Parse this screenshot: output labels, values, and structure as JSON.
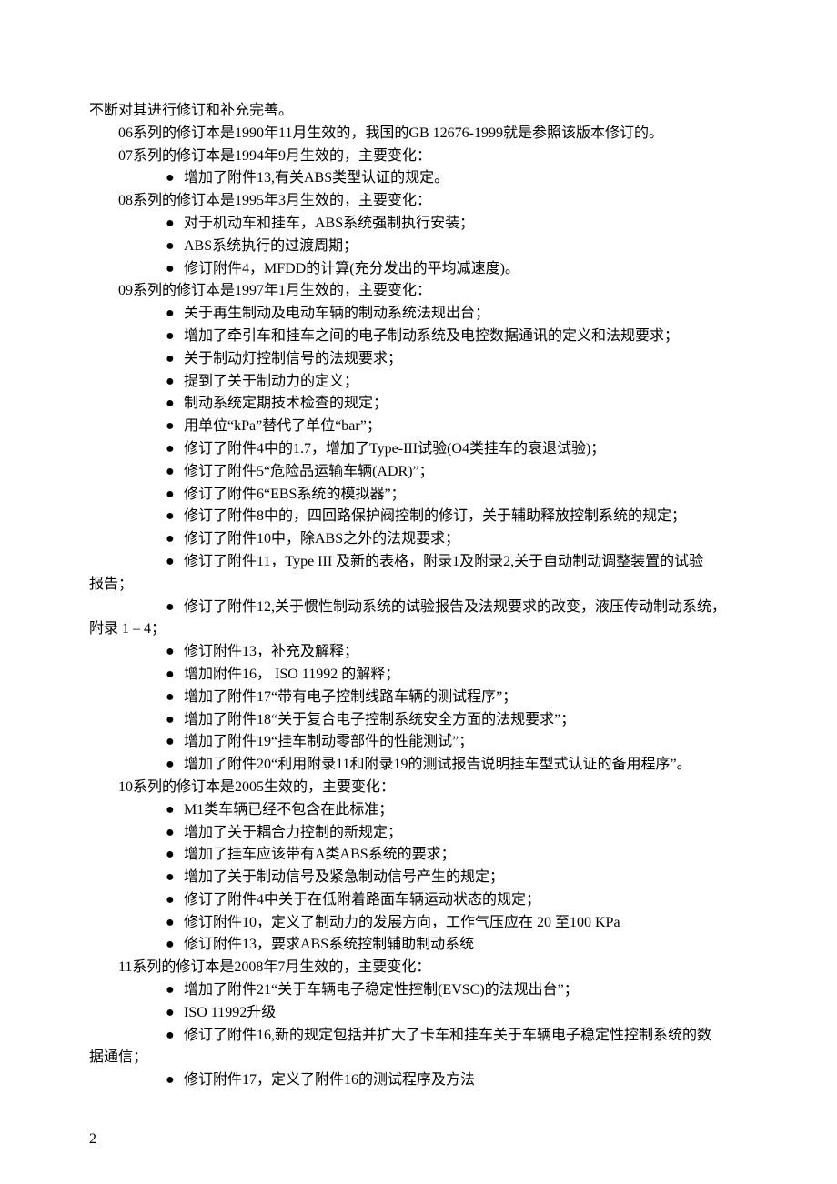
{
  "intro": "不断对其进行修订和补充完善。",
  "s06": "06系列的修订本是1990年11月生效的，我国的GB 12676-1999就是参照该版本修订的。",
  "s07_head": "07系列的修订本是1994年9月生效的，主要变化：",
  "s07": [
    "增加了附件13,有关ABS类型认证的规定。"
  ],
  "s08_head": "08系列的修订本是1995年3月生效的，主要变化：",
  "s08": [
    "对于机动车和挂车，ABS系统强制执行安装；",
    "ABS系统执行的过渡周期；",
    "修订附件4，MFDD的计算(充分发出的平均减速度)。"
  ],
  "s09_head": "09系列的修订本是1997年1月生效的，主要变化：",
  "s09a": [
    "关于再生制动及电动车辆的制动系统法规出台；",
    "增加了牵引车和挂车之间的电子制动系统及电控数据通讯的定义和法规要求；",
    "关于制动灯控制信号的法规要求；",
    "提到了关于制动力的定义；",
    "制动系统定期技术检查的规定；",
    "用单位“kPa”替代了单位“bar”；",
    "修订了附件4中的1.7，增加了Type-III试验(O4类挂车的衰退试验)；",
    "修订了附件5“危险品运输车辆(ADR)”；",
    "修订了附件6“EBS系统的模拟器”；",
    "修订了附件8中的，四回路保护阀控制的修订，关于辅助释放控制系统的规定；",
    "修订了附件10中，除ABS之外的法规要求；"
  ],
  "s09_wrap1": "修订了附件11，Type III 及新的表格，附录1及附录2,关于自动制动调整装置的试验",
  "s09_wrap1_cont": "报告；",
  "s09_wrap2": "修订了附件12,关于惯性制动系统的试验报告及法规要求的改变，液压传动制动系统，",
  "s09_wrap2_cont": "附录 1 – 4；",
  "s09b": [
    "修订附件13，补充及解释；",
    "增加附件16， ISO 11992 的解释；",
    "增加了附件17“带有电子控制线路车辆的测试程序”；",
    "增加了附件18“关于复合电子控制系统安全方面的法规要求”；",
    "增加了附件19“挂车制动零部件的性能测试”；",
    "增加了附件20“利用附录11和附录19的测试报告说明挂车型式认证的备用程序”。"
  ],
  "s10_head": "10系列的修订本是2005生效的，主要变化：",
  "s10": [
    "M1类车辆已经不包含在此标准；",
    "增加了关于耦合力控制的新规定；",
    "增加了挂车应该带有A类ABS系统的要求；",
    "增加了关于制动信号及紧急制动信号产生的规定；",
    "修订了附件4中关于在低附着路面车辆运动状态的规定；",
    "修订附件10，定义了制动力的发展方向，工作气压应在 20 至100 KPa",
    "修订附件13，要求ABS系统控制辅助制动系统"
  ],
  "s11_head": "11系列的修订本是2008年7月生效的，主要变化：",
  "s11a": [
    "增加了附件21“关于车辆电子稳定性控制(EVSC)的法规出台”；",
    "ISO 11992升级"
  ],
  "s11_wrap": "修订了附件16,新的规定包括并扩大了卡车和挂车关于车辆电子稳定性控制系统的数",
  "s11_wrap_cont": "据通信；",
  "s11b": [
    "修订附件17，定义了附件16的测试程序及方法"
  ],
  "page_number": "2"
}
